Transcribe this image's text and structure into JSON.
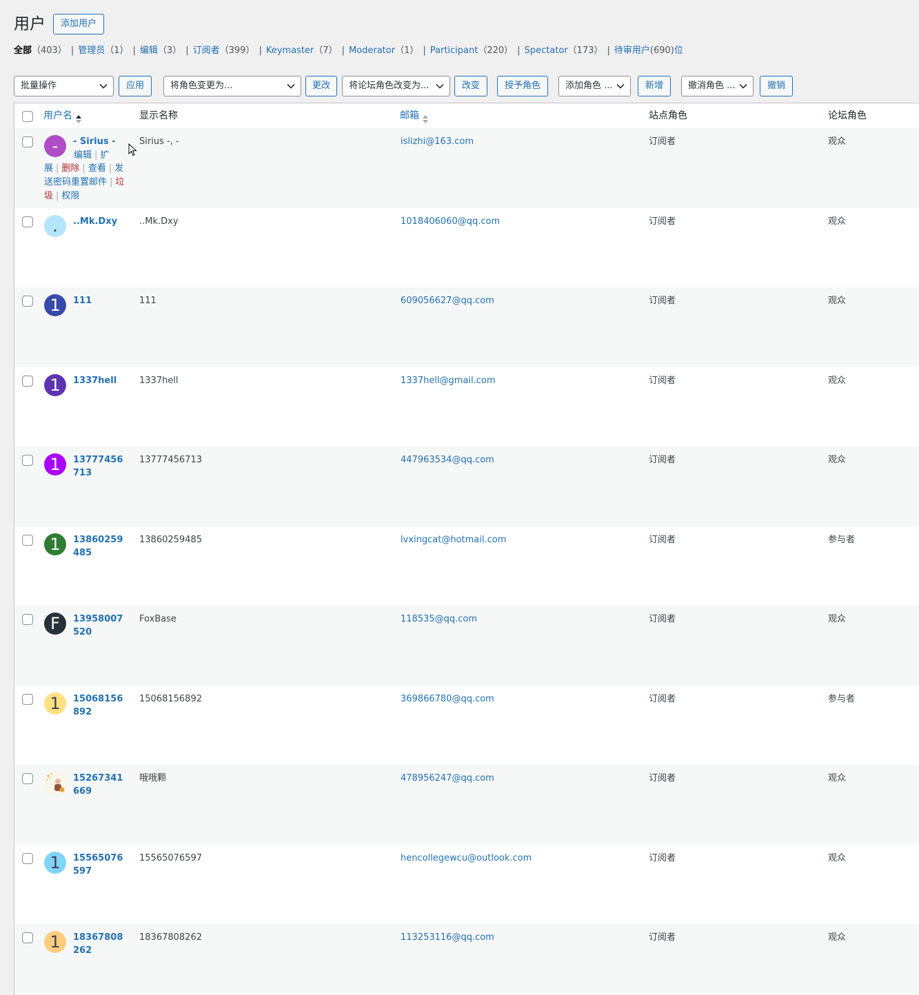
{
  "page": {
    "title": "用户",
    "add_user_label": "添加用户"
  },
  "filters": [
    {
      "label": "全部",
      "count": "（403）",
      "current": true
    },
    {
      "label": "管理员",
      "count": "（1）"
    },
    {
      "label": "编辑",
      "count": "（3）"
    },
    {
      "label": "订阅者",
      "count": "（399）"
    },
    {
      "label": "Keymaster",
      "count": "（7）"
    },
    {
      "label": "Moderator",
      "count": "（1）"
    },
    {
      "label": "Participant",
      "count": "（220）"
    },
    {
      "label": "Spectator",
      "count": "（173）"
    },
    {
      "label": "待审用户",
      "count": "(690)",
      "suffix": "位"
    }
  ],
  "filter_separator": "|",
  "toolbar": {
    "bulk_action": "批量操作",
    "apply": "应用",
    "change_role": "将角色变更为...",
    "change": "更改",
    "forum_role": "将论坛角色改变为...",
    "forum_change": "改变",
    "grant_role": "授予角色",
    "add_role": "添加角色 ...",
    "add_new": "新增",
    "revoke_role": "撤消角色 ...",
    "revoke": "撤销"
  },
  "columns": {
    "username": "用户名",
    "display_name": "显示名称",
    "email": "邮箱",
    "site_role": "站点角色",
    "forum_role": "论坛角色"
  },
  "row_actions": {
    "edit": "编辑",
    "extend": "扩展",
    "delete": "删除",
    "view": "查看",
    "send_reset": "发送密码重置邮件",
    "spam": "垃圾",
    "permissions": "权限",
    "sep": "|"
  },
  "users": [
    {
      "username": "- Sirius -",
      "display": "Sirius -, -",
      "email": "islizhi@163.com",
      "site_role": "订阅者",
      "forum_role": "观众",
      "avatar_letter": "-",
      "avatar_color": "#b04cc6",
      "avatar_text_color": "#ffffff",
      "hover": true
    },
    {
      "username": "..Mk.Dxy",
      "display": "..Mk.Dxy",
      "email": "1018406060@qq.com",
      "site_role": "订阅者",
      "forum_role": "观众",
      "avatar_letter": ".",
      "avatar_color": "#b3e5fc",
      "avatar_text_color": "#3c434a"
    },
    {
      "username": "111",
      "display": "111",
      "email": "609056627@qq.com",
      "site_role": "订阅者",
      "forum_role": "观众",
      "avatar_letter": "1",
      "avatar_color": "#3949ab",
      "avatar_text_color": "#ffffff"
    },
    {
      "username": "1337hell",
      "display": "1337hell",
      "email": "1337hell@gmail.com",
      "site_role": "订阅者",
      "forum_role": "观众",
      "avatar_letter": "1",
      "avatar_color": "#5e35b1",
      "avatar_text_color": "#ffffff"
    },
    {
      "username": "13777456713",
      "display": "13777456713",
      "email": "447963534@qq.com",
      "site_role": "订阅者",
      "forum_role": "观众",
      "avatar_letter": "1",
      "avatar_color": "#aa00ff",
      "avatar_text_color": "#ffffff"
    },
    {
      "username": "13860259485",
      "display": "13860259485",
      "email": "lvxingcat@hotmail.com",
      "site_role": "订阅者",
      "forum_role": "参与者",
      "avatar_letter": "1",
      "avatar_color": "#2e7d32",
      "avatar_text_color": "#ffffff"
    },
    {
      "username": "13958007520",
      "display": "FoxBase",
      "email": "118535@qq.com",
      "site_role": "订阅者",
      "forum_role": "观众",
      "avatar_letter": "F",
      "avatar_color": "#263238",
      "avatar_text_color": "#ffffff"
    },
    {
      "username": "15068156892",
      "display": "15068156892",
      "email": "369866780@qq.com",
      "site_role": "订阅者",
      "forum_role": "参与者",
      "avatar_letter": "1",
      "avatar_color": "#ffe082",
      "avatar_text_color": "#3c434a"
    },
    {
      "username": "15267341669",
      "display": "哦哦颗",
      "email": "478956247@qq.com",
      "site_role": "订阅者",
      "forum_role": "观众",
      "avatar_letter": "",
      "avatar_color": "#f3e9d7",
      "avatar_text_color": "#3c434a",
      "picture": true
    },
    {
      "username": "15565076597",
      "display": "15565076597",
      "email": "hencollegewcu@outlook.com",
      "site_role": "订阅者",
      "forum_role": "观众",
      "avatar_letter": "1",
      "avatar_color": "#81d4fa",
      "avatar_text_color": "#3c434a"
    },
    {
      "username": "18367808262",
      "display": "18367808262",
      "email": "113253116@qq.com",
      "site_role": "订阅者",
      "forum_role": "观众",
      "avatar_letter": "1",
      "avatar_color": "#ffcc80",
      "avatar_text_color": "#3c434a"
    }
  ]
}
